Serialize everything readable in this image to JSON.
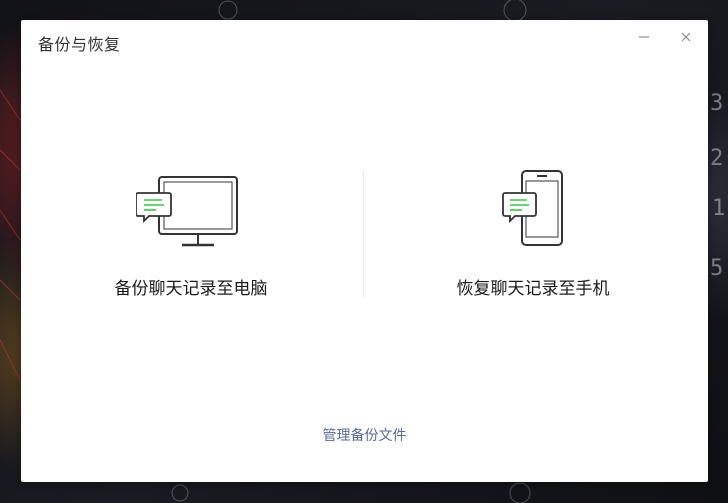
{
  "dialog": {
    "title": "备份与恢复",
    "minimize_icon": "minimize-icon",
    "close_icon": "close-icon"
  },
  "options": [
    {
      "label": "备份聊天记录至电脑",
      "icon": "monitor-chat-icon"
    },
    {
      "label": "恢复聊天记录至手机",
      "icon": "phone-chat-icon"
    }
  ],
  "footer": {
    "manage_label": "管理备份文件"
  },
  "colors": {
    "link": "#576b95",
    "chat_bubble_lines": "#3cc24a",
    "dialog_bg": "#ffffff"
  }
}
